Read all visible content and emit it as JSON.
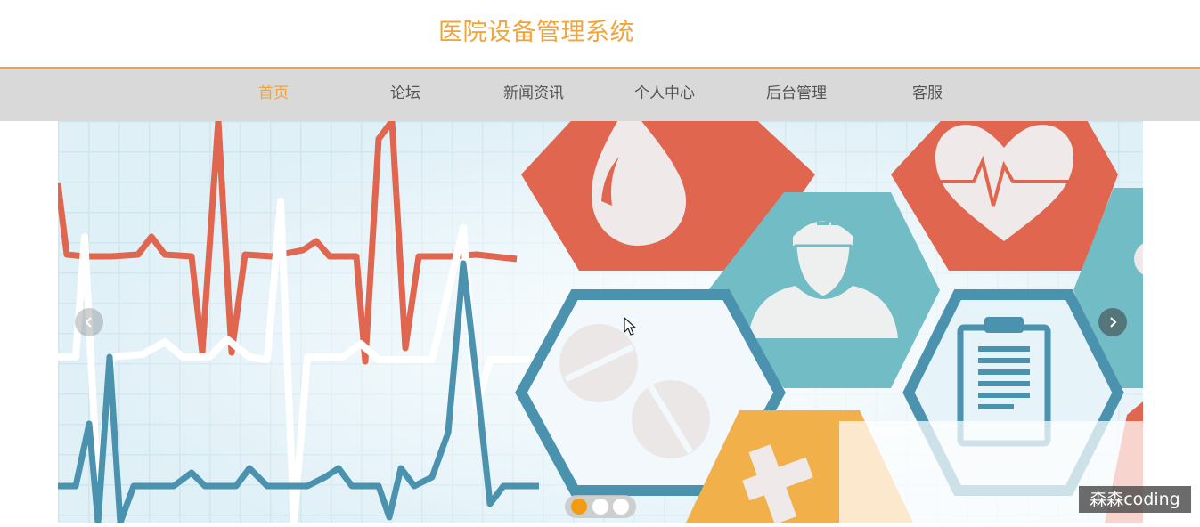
{
  "header": {
    "title": "医院设备管理系统"
  },
  "nav": {
    "items": [
      {
        "label": "首页",
        "active": true
      },
      {
        "label": "论坛"
      },
      {
        "label": "新闻资讯"
      },
      {
        "label": "个人中心"
      },
      {
        "label": "后台管理"
      },
      {
        "label": "客服"
      }
    ]
  },
  "carousel": {
    "slide_count": 3,
    "active_slide": 1,
    "icons": [
      "prev-arrow-icon",
      "next-arrow-icon",
      "blood-drop-icon",
      "heart-pulse-icon",
      "doctor-icon",
      "pills-icon",
      "clipboard-icon",
      "medical-cross-icon"
    ]
  },
  "watermark": {
    "text": "森森coding"
  },
  "colors": {
    "accent": "#f0a43a",
    "nav_bg": "#d9d9d9",
    "red": "#e0664f",
    "teal": "#72bcc6",
    "blue": "#4a92ad",
    "orange": "#f2b04b"
  }
}
